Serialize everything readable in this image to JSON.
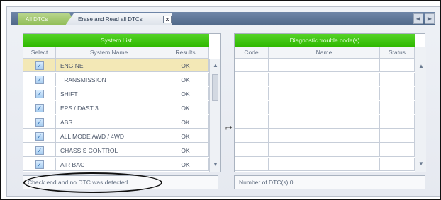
{
  "tabs": {
    "all_dtcs": "All DTCs",
    "erase_read": "Erase and Read all DTCs",
    "close": "x",
    "nav_prev": "◀",
    "nav_next": "▶"
  },
  "system_list": {
    "title": "System List",
    "headers": [
      "Select",
      "System Name",
      "Results"
    ],
    "rows": [
      {
        "name": "ENGINE",
        "result": "OK",
        "checked": "✓"
      },
      {
        "name": "TRANSMISSION",
        "result": "OK",
        "checked": "✓"
      },
      {
        "name": "SHIFT",
        "result": "OK",
        "checked": "✓"
      },
      {
        "name": "EPS / DAST 3",
        "result": "OK",
        "checked": "✓"
      },
      {
        "name": "ABS",
        "result": "OK",
        "checked": "✓"
      },
      {
        "name": "ALL MODE AWD / 4WD",
        "result": "OK",
        "checked": "✓"
      },
      {
        "name": "CHASSIS CONTROL",
        "result": "OK",
        "checked": "✓"
      },
      {
        "name": "AIR BAG",
        "result": "OK",
        "checked": "✓"
      }
    ],
    "scroll_up": "▲",
    "scroll_down": "▼"
  },
  "dtc": {
    "title": "Diagnostic trouble code(s)",
    "headers": [
      "Code",
      "Name",
      "Status"
    ],
    "scroll_up": "▲",
    "scroll_down": "▼"
  },
  "status": {
    "message": "Check end and no DTC was detected.",
    "count": "Number of DTC(s):0"
  },
  "colors": {
    "title_green": "#2fb800",
    "tab_bar": "#5a7295",
    "highlight_row": "#f3e8b6"
  }
}
